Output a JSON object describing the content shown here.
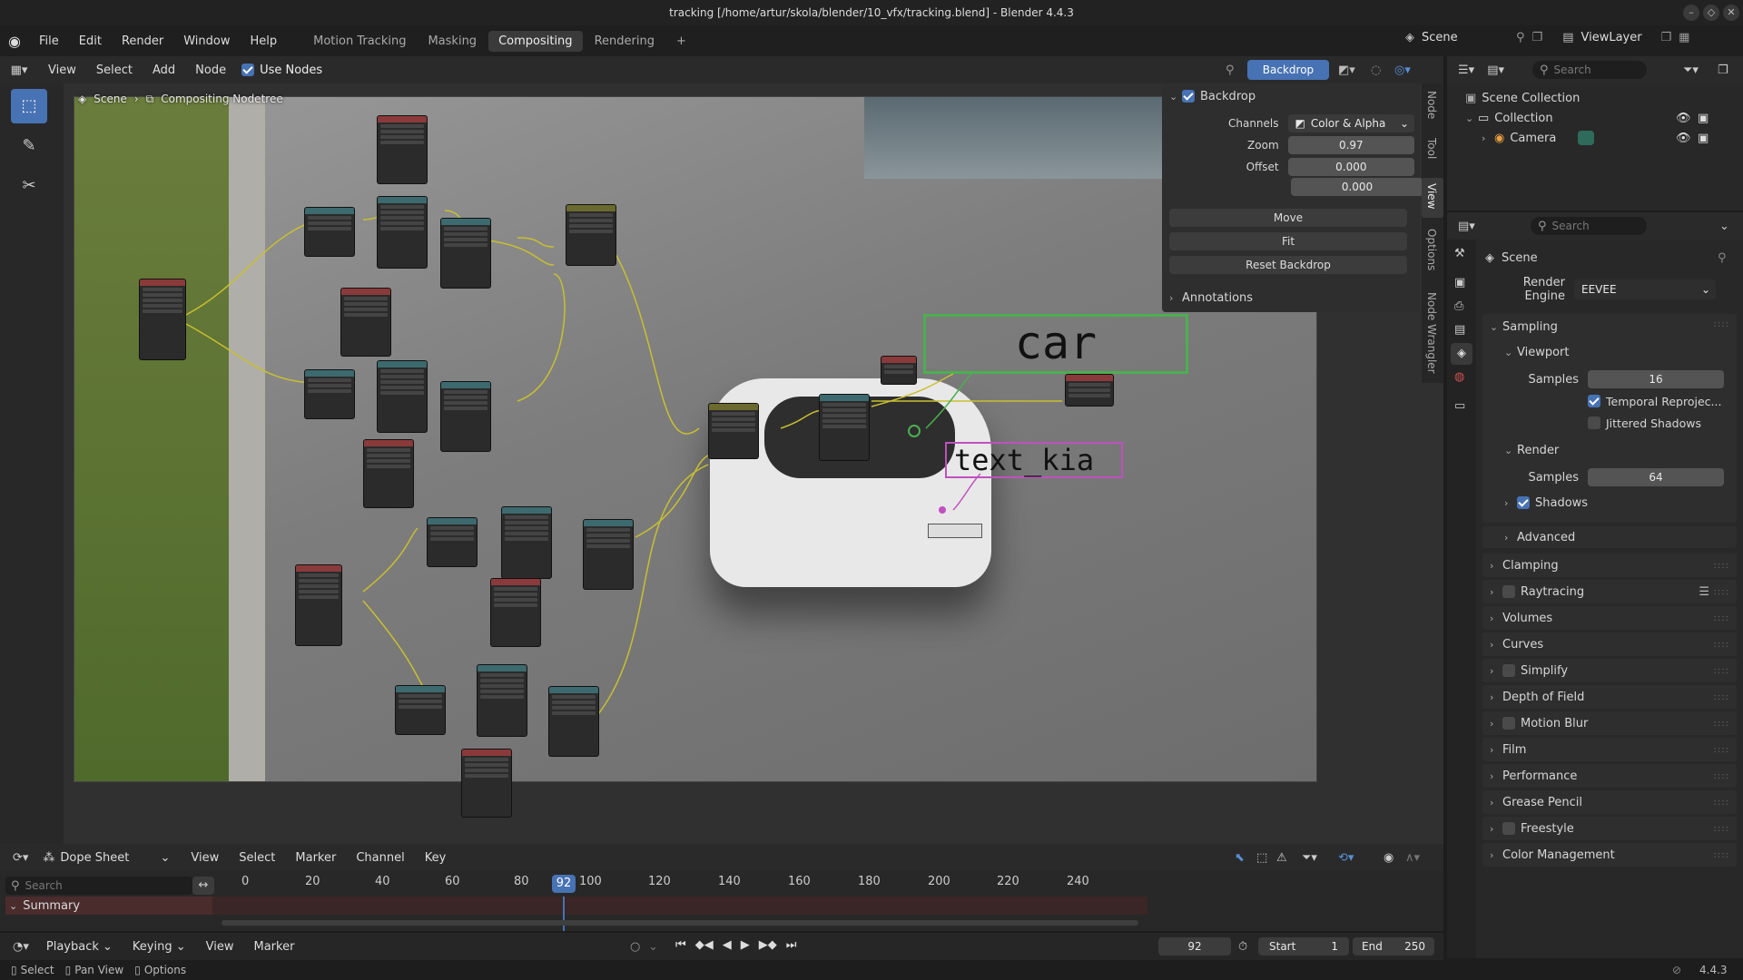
{
  "window": {
    "title": "tracking [/home/artur/skola/blender/10_vfx/tracking.blend] - Blender 4.4.3"
  },
  "menu": [
    "File",
    "Edit",
    "Render",
    "Window",
    "Help"
  ],
  "workspaces": [
    "Motion Tracking",
    "Masking",
    "Compositing",
    "Rendering"
  ],
  "active_workspace": "Compositing",
  "scene_selector": "Scene",
  "view_layer": "ViewLayer",
  "node_editor": {
    "menus": [
      "View",
      "Select",
      "Add",
      "Node"
    ],
    "use_nodes_label": "Use Nodes",
    "backdrop_button": "Backdrop",
    "breadcrumb": [
      "Scene",
      "Compositing Nodetree"
    ],
    "overlay_texts": {
      "car": "car",
      "kia": "text_kia"
    },
    "side_tabs": [
      "Node",
      "Tool",
      "View",
      "Options",
      "Node Wrangler"
    ]
  },
  "backdrop_panel": {
    "title": "Backdrop",
    "channels_label": "Channels",
    "channels_value": "Color & Alpha",
    "zoom_label": "Zoom",
    "zoom_value": "0.97",
    "offset_label": "Offset",
    "offset_x": "0.000",
    "offset_y": "0.000",
    "move": "Move",
    "fit": "Fit",
    "reset": "Reset Backdrop",
    "annotations": "Annotations"
  },
  "outliner": {
    "search_placeholder": "Search",
    "scene_collection": "Scene Collection",
    "collection": "Collection",
    "camera": "Camera"
  },
  "properties": {
    "search_placeholder": "Search",
    "context": "Scene",
    "render_engine_label": "Render Engine",
    "render_engine_value": "EEVEE",
    "sampling": "Sampling",
    "viewport": "Viewport",
    "samples_label": "Samples",
    "viewport_samples": "16",
    "temporal": "Temporal Reprojec...",
    "jittered": "Jittered Shadows",
    "render": "Render",
    "render_samples": "64",
    "shadows": "Shadows",
    "advanced": "Advanced",
    "sections": [
      "Clamping",
      "Raytracing",
      "Volumes",
      "Curves",
      "Simplify",
      "Depth of Field",
      "Motion Blur",
      "Film",
      "Performance",
      "Grease Pencil",
      "Freestyle",
      "Color Management"
    ]
  },
  "dopesheet": {
    "editor": "Dope Sheet",
    "menus": [
      "View",
      "Select",
      "Marker",
      "Channel",
      "Key"
    ],
    "search_placeholder": "Search",
    "summary": "Summary",
    "ticks": [
      "0",
      "20",
      "40",
      "60",
      "80",
      "100",
      "120",
      "140",
      "160",
      "180",
      "200",
      "220",
      "240"
    ],
    "current_frame": "92"
  },
  "timeline": {
    "menus": [
      "Playback",
      "Keying",
      "View",
      "Marker"
    ],
    "frame": "92",
    "start_label": "Start",
    "start_value": "1",
    "end_label": "End",
    "end_value": "250"
  },
  "statusbar": {
    "select": "Select",
    "pan": "Pan View",
    "options": "Options",
    "version": "4.4.3"
  },
  "colors": {
    "accent": "#4772b3",
    "active_tab": "#3a3a3a",
    "car_box": "#4caf50",
    "kia_box": "#c050c0",
    "link": "#c8c030"
  }
}
